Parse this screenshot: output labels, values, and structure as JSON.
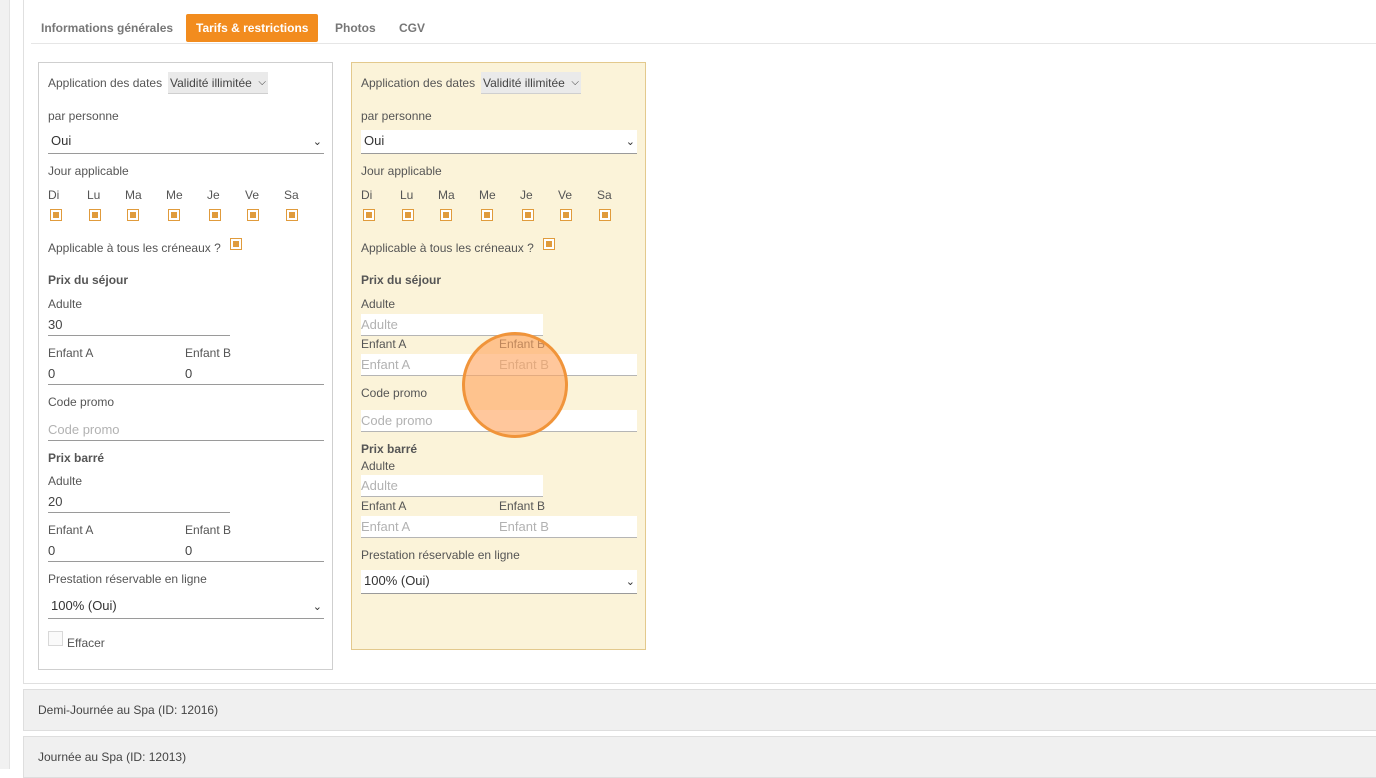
{
  "tabs": [
    {
      "label": "Informations générales",
      "active": false
    },
    {
      "label": "Tarifs & restrictions",
      "active": true
    },
    {
      "label": "Photos",
      "active": false
    },
    {
      "label": "CGV",
      "active": false
    }
  ],
  "left_card": {
    "date_app_label": "Application des dates",
    "date_app_value": "Validité illimitée",
    "per_person_label": "par personne",
    "per_person_value": "Oui",
    "day_label": "Jour applicable",
    "days": [
      "Di",
      "Lu",
      "Ma",
      "Me",
      "Je",
      "Ve",
      "Sa"
    ],
    "all_slots_label": "Applicable à tous les créneaux ?",
    "stay_price_label": "Prix du séjour",
    "adult_label": "Adulte",
    "adult_value": "30",
    "child_a_label": "Enfant A",
    "child_a_value": "0",
    "child_b_label": "Enfant B",
    "child_b_value": "0",
    "promo_label": "Code promo",
    "promo_placeholder": "Code promo",
    "strike_label": "Prix barré",
    "strike_adult_label": "Adulte",
    "strike_adult_value": "20",
    "strike_child_a_label": "Enfant A",
    "strike_child_a_value": "0",
    "strike_child_b_label": "Enfant B",
    "strike_child_b_value": "0",
    "online_label": "Prestation réservable en ligne",
    "online_value": "100% (Oui)",
    "delete_label": "Effacer"
  },
  "right_card": {
    "date_app_label": "Application des dates",
    "date_app_value": "Validité illimitée",
    "per_person_label": "par personne",
    "per_person_value": "Oui",
    "day_label": "Jour applicable",
    "days": [
      "Di",
      "Lu",
      "Ma",
      "Me",
      "Je",
      "Ve",
      "Sa"
    ],
    "all_slots_label": "Applicable à tous les créneaux ?",
    "stay_price_label": "Prix du séjour",
    "adult_label": "Adulte",
    "adult_placeholder": "Adulte",
    "child_a_label": "Enfant A",
    "child_a_placeholder": "Enfant A",
    "child_b_label": "Enfant B",
    "child_b_placeholder": "Enfant B",
    "promo_label": "Code promo",
    "promo_placeholder": "Code promo",
    "strike_label": "Prix barré",
    "strike_adult_label": "Adulte",
    "strike_adult_placeholder": "Adulte",
    "strike_child_a_label": "Enfant A",
    "strike_child_a_placeholder": "Enfant A",
    "strike_child_b_label": "Enfant B",
    "strike_child_b_placeholder": "Enfant B",
    "online_label": "Prestation réservable en ligne",
    "online_value": "100% (Oui)"
  },
  "accordions": [
    {
      "label": "Demi-Journée au Spa (ID: 12016)"
    },
    {
      "label": "Journée au Spa (ID: 12013)"
    }
  ],
  "colors": {
    "accent": "#f28c1e",
    "card_highlight": "#fbf3d9",
    "checkbox": "#e09b3c"
  }
}
